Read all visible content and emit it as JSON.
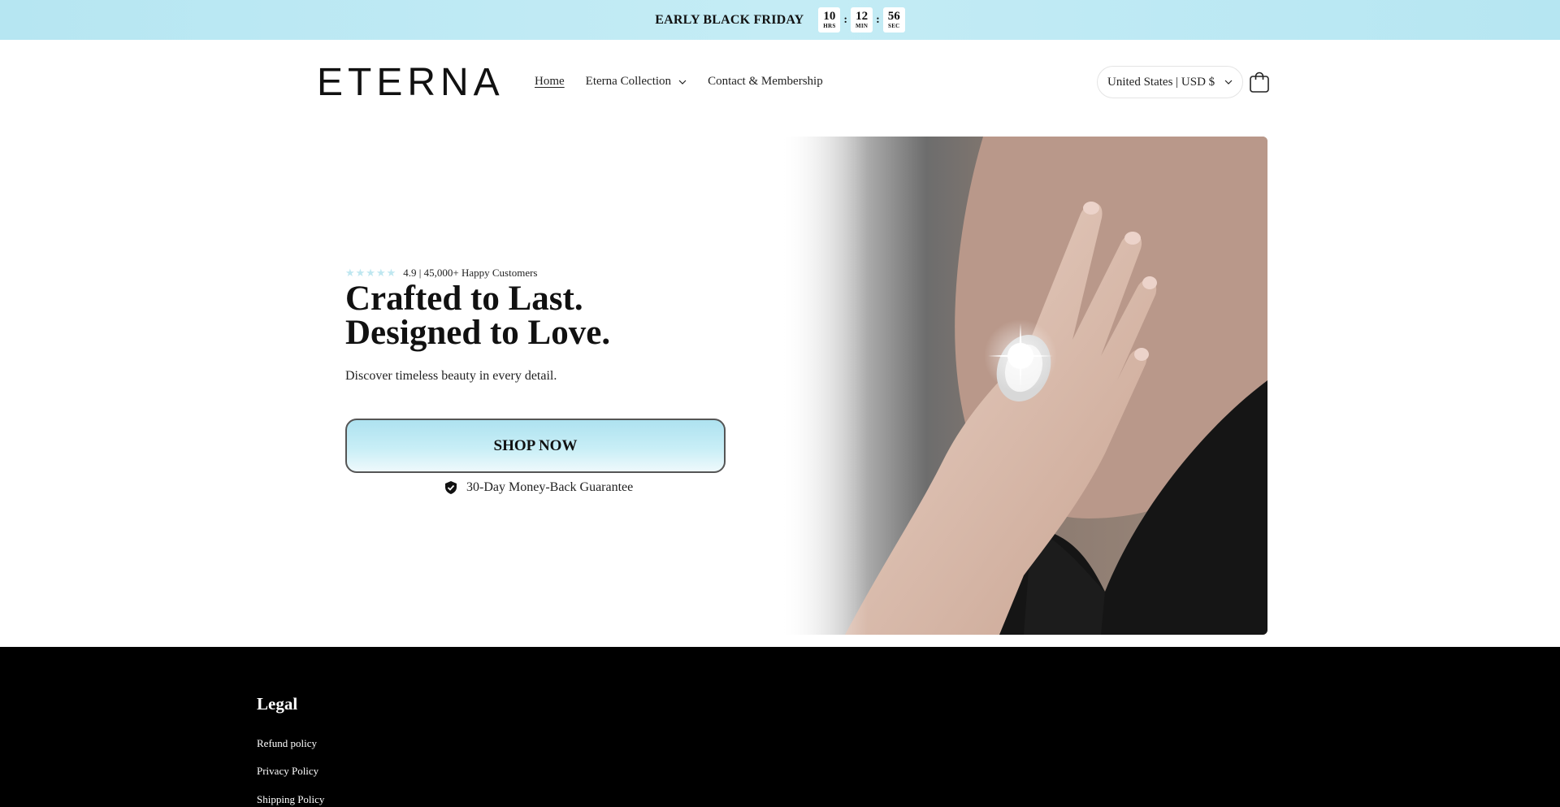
{
  "announcement": {
    "text": "EARLY BLACK FRIDAY",
    "timer": [
      {
        "value": "10",
        "label": "HRS"
      },
      {
        "value": "12",
        "label": "MIN"
      },
      {
        "value": "56",
        "label": "SEC"
      }
    ],
    "separator": ":",
    "background": "#b6e6f2"
  },
  "header": {
    "logo": "ETERNA",
    "nav": [
      {
        "label": "Home",
        "active": true
      },
      {
        "label": "Eterna Collection",
        "has_dropdown": true
      },
      {
        "label": "Contact & Membership"
      }
    ],
    "country_selector": "United States | USD $",
    "cart_icon": "shopping-bag-icon"
  },
  "hero": {
    "stars": "★★★★★",
    "rating_text": "4.9 | 45,000+ Happy Customers",
    "title": "Crafted to Last. Designed to Love.",
    "subtitle": "Discover timeless beauty in every detail.",
    "cta_label": "SHOP NOW",
    "guarantee": "30-Day Money-Back Guarantee",
    "guarantee_icon": "shield-check-icon",
    "image": "hand-with-diamond-ring-photo",
    "accent_color": "#c4ecf5"
  },
  "footer": {
    "title": "Legal",
    "links": [
      "Refund policy",
      "Privacy Policy",
      "Shipping Policy"
    ]
  }
}
